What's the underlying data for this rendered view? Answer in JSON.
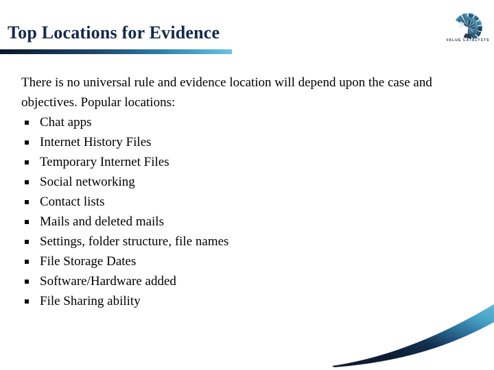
{
  "slide": {
    "title": "Top Locations for Evidence",
    "intro": "There is no universal rule and evidence location will depend upon the case and objectives.  Popular locations:",
    "bullets": [
      "Chat apps",
      "Internet History Files",
      "Temporary Internet Files",
      "Social networking",
      "Contact lists",
      "Mails and deleted mails",
      "Settings, folder structure, file names",
      "File Storage Dates",
      "Software/Hardware added",
      "File Sharing ability"
    ]
  },
  "logo": {
    "mark_name": "segmented-ring-logo-icon",
    "wordmark": "VALUE CATALYSTS"
  },
  "colors": {
    "title_navy": "#12294f",
    "rule_dark": "#0b1526",
    "rule_light": "#6fc4dd",
    "swoosh_dark": "#0d1b33",
    "swoosh_light": "#58b4d6",
    "background": "#ffffff",
    "body_text": "#000000"
  }
}
